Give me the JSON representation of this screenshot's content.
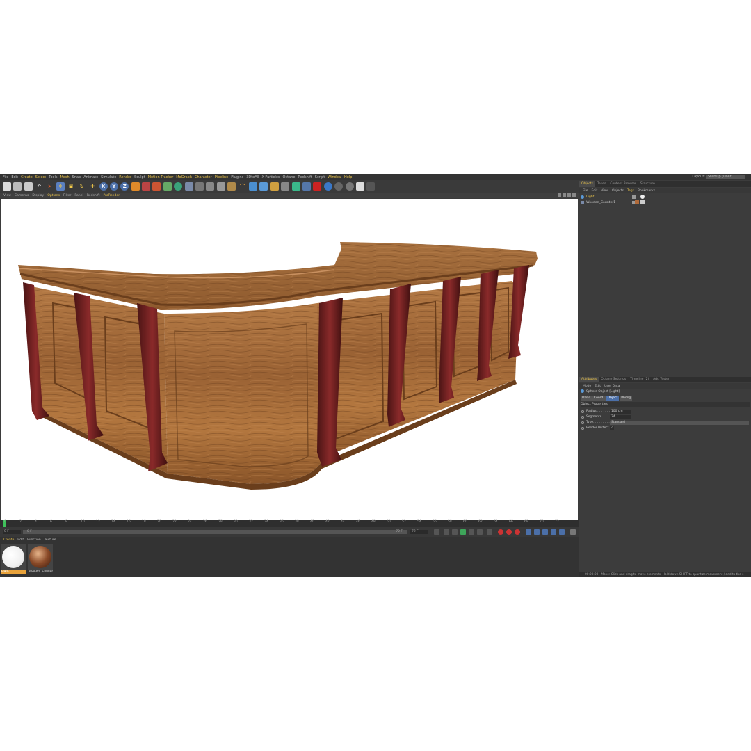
{
  "menu": [
    "File",
    "Edit",
    "Create",
    "Select",
    "Tools",
    "Mesh",
    "Snap",
    "Animate",
    "Simulate",
    "Render",
    "Sculpt",
    "Motion Tracker",
    "MoGraph",
    "Character",
    "Pipeline",
    "Plugins",
    "3DtoAll",
    "X-Particles",
    "Octane",
    "Redshift",
    "Script",
    "Window",
    "Help"
  ],
  "layout": {
    "label": "Layout:",
    "value": "Startup (User)"
  },
  "toolbar": {
    "x_label": "X",
    "y_label": "Y",
    "z_label": "Z"
  },
  "viewport_menu": [
    "View",
    "Cameras",
    "Display",
    "Options",
    "Filter",
    "Panel",
    "Redshift",
    "ProRender"
  ],
  "timeline": {
    "ticks": [
      "0",
      "2",
      "4",
      "6",
      "8",
      "10",
      "12",
      "14",
      "16",
      "18",
      "20",
      "22",
      "24",
      "26",
      "28",
      "30",
      "32",
      "34",
      "36",
      "38",
      "40",
      "42",
      "44",
      "46",
      "48",
      "50",
      "52",
      "54",
      "56",
      "58",
      "60",
      "62",
      "64",
      "66",
      "68",
      "70",
      "72"
    ],
    "current_frame": "0 F",
    "start": "0 F",
    "min": "0 F",
    "max": "72 F",
    "end": "72 F"
  },
  "material_menu": [
    "Create",
    "Edit",
    "Function",
    "Texture"
  ],
  "materials": [
    {
      "name": "Light"
    },
    {
      "name": "Wooden_Counte"
    }
  ],
  "object_tabs": [
    "Objects",
    "Takes",
    "Content Browser",
    "Structure"
  ],
  "object_menu": [
    "File",
    "Edit",
    "View",
    "Objects",
    "Tags",
    "Bookmarks"
  ],
  "objects": [
    {
      "name": "Light"
    },
    {
      "name": "Wooden_Counter1"
    }
  ],
  "attr_tabs": [
    "Attributes",
    "Octane Settings",
    "Timeline (2)",
    "Add Tester"
  ],
  "attr_menu": [
    "Mode",
    "Edit",
    "User Data"
  ],
  "attributes": {
    "object_title": "Sphere Object [Light]",
    "subtabs": [
      "Basic",
      "Coord.",
      "Object",
      "Phong"
    ],
    "section": "Object Properties",
    "props": [
      {
        "label": "Radius . . . . . . .",
        "value": "100 cm"
      },
      {
        "label": "Segments . . . . .",
        "value": "24"
      },
      {
        "label": "Type. . . . . . . . .",
        "value": "Standard"
      },
      {
        "label": "Render Perfect",
        "value": "✓"
      }
    ]
  },
  "status": {
    "time": "00:00:00",
    "message": "Move: Click and drag to move elements. Hold down SHIFT to quantize movement / add to the s"
  }
}
